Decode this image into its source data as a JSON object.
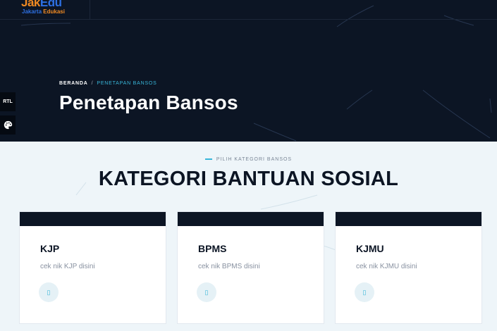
{
  "logo": {
    "main_a": "Jak",
    "main_b": "Edu",
    "sub_a": "Jakarta",
    "sub_b": "Edukasi"
  },
  "breadcrumb": {
    "home": "BERANDA",
    "separator": "/",
    "current": "PENETAPAN BANSOS"
  },
  "page_title": "Penetapan Bansos",
  "side": {
    "rtl_label": "RTL",
    "palette_icon": "palette-icon"
  },
  "section": {
    "eyebrow": "PILIH KATEGORI BANSOS",
    "title": "KATEGORI BANTUAN SOSIAL"
  },
  "cards": [
    {
      "title": "KJP",
      "desc": "cek nik KJP disini",
      "icon": "▯"
    },
    {
      "title": "BPMS",
      "desc": "cek nik BPMS disini",
      "icon": "▯"
    },
    {
      "title": "KJMU",
      "desc": "cek nik KJMU disini",
      "icon": "▯"
    }
  ],
  "colors": {
    "navy": "#0c1524",
    "accent": "#38b6d9",
    "logo_orange": "#f08a22",
    "logo_blue": "#2d6fe0",
    "section_bg": "#eef5f9"
  }
}
